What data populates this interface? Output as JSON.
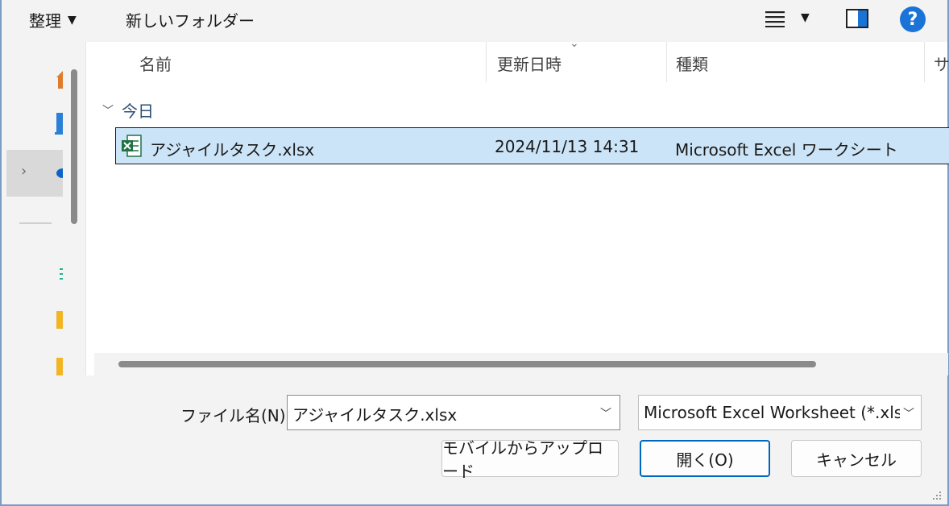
{
  "toolbar": {
    "organize_label": "整理",
    "new_folder_label": "新しいフォルダー",
    "view_icon": "list-view-icon",
    "pane_icon": "preview-pane-icon",
    "help_icon": "help-icon",
    "help_glyph": "?"
  },
  "columns": [
    {
      "label": "名前"
    },
    {
      "label": "更新日時"
    },
    {
      "label": "種類"
    },
    {
      "label": "サ"
    }
  ],
  "group": {
    "label": "今日"
  },
  "files": [
    {
      "name": "アジャイルタスク.xlsx",
      "modified": "2024/11/13 14:31",
      "type": "Microsoft Excel ワークシート",
      "selected": true,
      "icon": "excel-file-icon"
    }
  ],
  "bottom": {
    "file_name_label": "ファイル名(N):",
    "file_name_value": "アジャイルタスク.xlsx",
    "file_type_value": "Microsoft Excel Worksheet (*.xls",
    "upload_button": "モバイルからアップロード",
    "open_button": "開く(O)",
    "cancel_button": "キャンセル"
  },
  "colors": {
    "selection_bg": "#cce4f7",
    "accent": "#0067c0",
    "help_blue": "#1a73d6",
    "excel_green": "#1f7244"
  }
}
